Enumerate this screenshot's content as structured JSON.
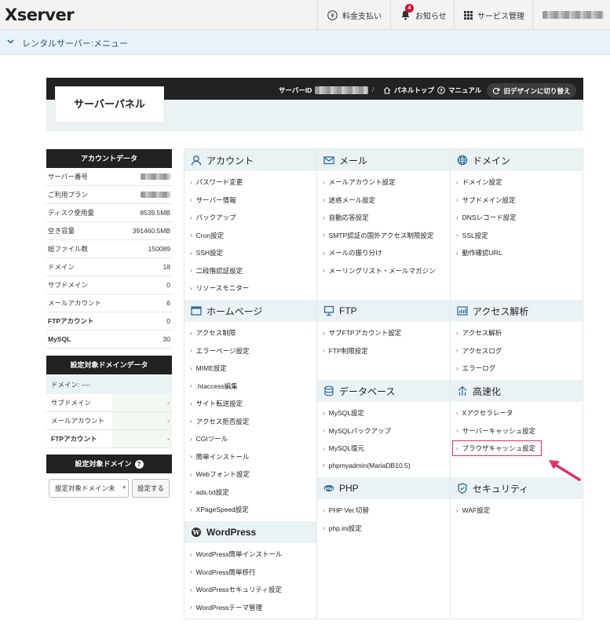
{
  "header": {
    "logo": "Xserver",
    "nav": {
      "payment": "料金支払い",
      "notices": "お知らせ",
      "notice_count": "4",
      "services": "サービス管理"
    }
  },
  "menubar": {
    "label": "レンタルサーバー:メニュー"
  },
  "panel": {
    "title": "サーバーパネル",
    "server_label": "サーバーID",
    "top_link": "パネルトップ",
    "manual_link": "マニュアル",
    "old_design": "旧デザインに切り替え"
  },
  "account": {
    "heading": "アカウントデータ",
    "rows": [
      {
        "k": "サーバー番号",
        "v": ""
      },
      {
        "k": "ご利用プラン",
        "v": ""
      },
      {
        "k": "ディスク使用量",
        "v": "8539.5MB"
      },
      {
        "k": "空き容量",
        "v": "391460.5MB"
      },
      {
        "k": "総ファイル数",
        "v": "150089"
      },
      {
        "k": "ドメイン",
        "v": "18"
      },
      {
        "k": "サブドメイン",
        "v": "0"
      },
      {
        "k": "メールアカウント",
        "v": "6"
      },
      {
        "k": "FTPアカウント",
        "v": "0"
      },
      {
        "k": "MySQL",
        "v": "30"
      }
    ]
  },
  "domain_data": {
    "heading": "設定対象ドメインデータ",
    "domain": "ドメイン: ----",
    "rows": [
      {
        "k": "サブドメイン",
        "v": "-"
      },
      {
        "k": "メールアカウント",
        "v": "-"
      },
      {
        "k": "FTPアカウント",
        "v": "-"
      }
    ]
  },
  "domain_select": {
    "heading": "設定対象ドメイン",
    "select_value": "設定対象ドメイン未",
    "button": "設定する"
  },
  "sections": {
    "account": {
      "title": "アカウント",
      "items": [
        "パスワード変更",
        "サーバー情報",
        "バックアップ",
        "Cron設定",
        "SSH設定",
        "二段階認証設定",
        "リソースモニター"
      ]
    },
    "mail": {
      "title": "メール",
      "items": [
        "メールアカウント設定",
        "迷惑メール設定",
        "自動応答設定",
        "SMTP認証の国外アクセス制限設定",
        "メールの振り分け",
        "メーリングリスト・メールマガジン"
      ]
    },
    "domain": {
      "title": "ドメイン",
      "items": [
        "ドメイン設定",
        "サブドメイン設定",
        "DNSレコード設定",
        "SSL設定",
        "動作確認URL"
      ]
    },
    "homepage": {
      "title": "ホームページ",
      "items": [
        "アクセス制限",
        "エラーページ設定",
        "MIME設定",
        ".htaccess編集",
        "サイト転送設定",
        "アクセス拒否設定",
        "CGIツール",
        "簡単インストール",
        "Webフォント設定",
        "ads.txt設定",
        "XPageSpeed設定"
      ]
    },
    "ftp": {
      "title": "FTP",
      "items": [
        "サブFTPアカウント設定",
        "FTP制限設定"
      ]
    },
    "access": {
      "title": "アクセス解析",
      "items": [
        "アクセス解析",
        "アクセスログ",
        "エラーログ"
      ]
    },
    "database": {
      "title": "データベース",
      "items": [
        "MySQL設定",
        "MySQLバックアップ",
        "MySQL復元",
        "phpmyadmin(MariaDB10.5)"
      ]
    },
    "speed": {
      "title": "高速化",
      "items": [
        "Xアクセラレータ",
        "サーバーキャッシュ設定",
        "ブラウザキャッシュ設定"
      ]
    },
    "php": {
      "title": "PHP",
      "items": [
        "PHP Ver.切替",
        "php.ini設定"
      ]
    },
    "security": {
      "title": "セキュリティ",
      "items": [
        "WAF設定"
      ]
    },
    "wordpress": {
      "title": "WordPress",
      "items": [
        "WordPress簡単インストール",
        "WordPress簡単移行",
        "WordPressセキュリティ設定",
        "WordPressテーマ管理"
      ]
    }
  },
  "colors": {
    "accent": "#1c5a86",
    "highlight": "#e0306a"
  }
}
